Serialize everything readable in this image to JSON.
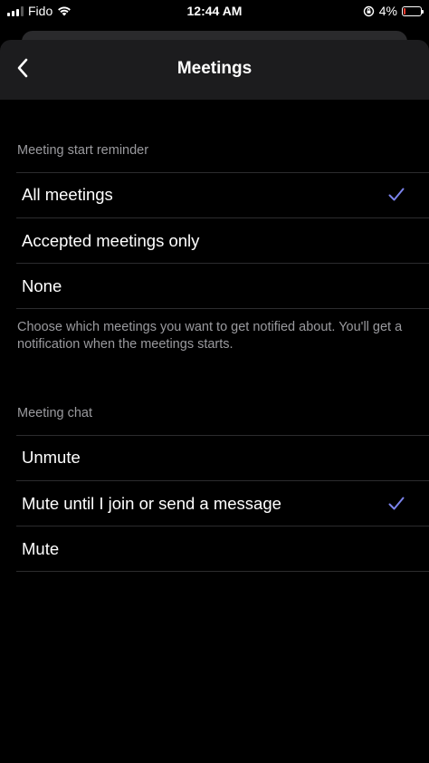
{
  "status_bar": {
    "carrier": "Fido",
    "time": "12:44 AM",
    "battery_percent": "4%",
    "battery_level": 0.04,
    "battery_color": "#ff3b30"
  },
  "nav": {
    "title": "Meetings",
    "back_icon": "chevron-left-icon"
  },
  "reminder_section": {
    "header": "Meeting start reminder",
    "options": [
      {
        "label": "All meetings",
        "selected": true
      },
      {
        "label": "Accepted meetings only",
        "selected": false
      },
      {
        "label": "None",
        "selected": false
      }
    ],
    "footer": "Choose which meetings you want to get notified about. You'll get a notification when the meetings starts."
  },
  "chat_section": {
    "header": "Meeting chat",
    "options": [
      {
        "label": "Unmute",
        "selected": false
      },
      {
        "label": "Mute until I join or send a message",
        "selected": true
      },
      {
        "label": "Mute",
        "selected": false
      }
    ]
  },
  "colors": {
    "accent": "#7b83eb",
    "background": "#000000",
    "nav_background": "#1c1c1e",
    "secondary_text": "#9a9a9e"
  }
}
